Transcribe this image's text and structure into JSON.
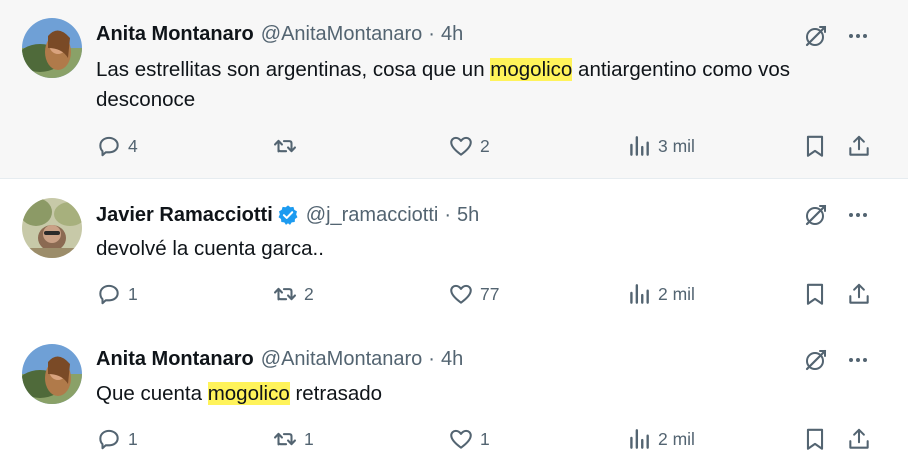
{
  "tweets": [
    {
      "name": "Anita Montanaro",
      "verified": false,
      "handle": "@AnitaMontanaro",
      "sep": "·",
      "time": "4h",
      "text_before": "Las estrellitas son argentinas, cosa que un ",
      "highlight": "mogolico",
      "text_after": " antiargentino como vos desconoce",
      "replies": "4",
      "retweets": "",
      "likes": "2",
      "views": "3 mil"
    },
    {
      "name": "Javier Ramacciotti",
      "verified": true,
      "handle": "@j_ramacciotti",
      "sep": "·",
      "time": "5h",
      "text_before": "devolvé la cuenta garca..",
      "highlight": "",
      "text_after": "",
      "replies": "1",
      "retweets": "2",
      "likes": "77",
      "views": "2 mil"
    },
    {
      "name": "Anita Montanaro",
      "verified": false,
      "handle": "@AnitaMontanaro",
      "sep": "·",
      "time": "4h",
      "text_before": "Que cuenta ",
      "highlight": "mogolico",
      "text_after": " retrasado",
      "replies": "1",
      "retweets": "1",
      "likes": "1",
      "views": "2 mil"
    }
  ],
  "colors": {
    "text": "#0f1419",
    "secondary": "#536471",
    "highlight": "#fff35a",
    "verified": "#1d9bf0",
    "thread_line": "#cfd9de",
    "hover_background": "#f7f7f7"
  },
  "icons": [
    "grok-icon",
    "more-icon",
    "reply-icon",
    "retweet-icon",
    "like-icon",
    "views-icon",
    "bookmark-icon",
    "share-icon",
    "verified-badge-icon"
  ]
}
